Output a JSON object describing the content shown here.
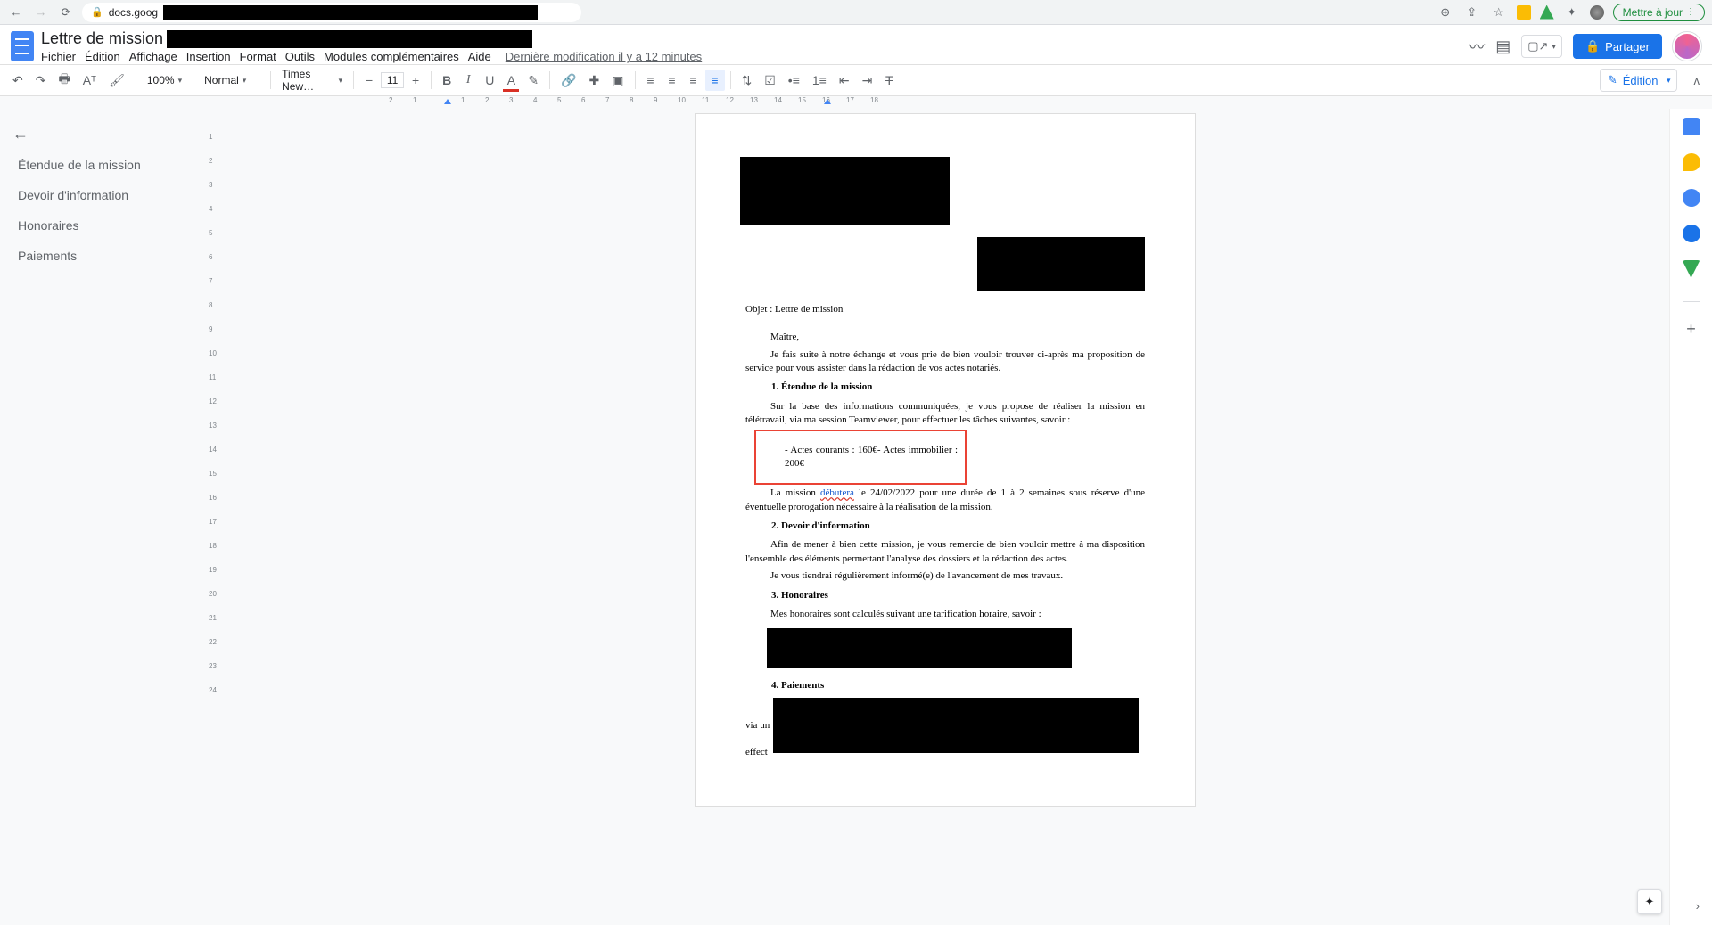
{
  "browser": {
    "url_visible": "docs.goog",
    "update_label": "Mettre à jour"
  },
  "doc": {
    "title": "Lettre de mission",
    "last_edit": "Dernière modification il y a 12 minutes"
  },
  "menus": {
    "file": "Fichier",
    "edit": "Édition",
    "view": "Affichage",
    "insert": "Insertion",
    "format": "Format",
    "tools": "Outils",
    "addons": "Modules complémentaires",
    "help": "Aide"
  },
  "header_actions": {
    "share": "Partager"
  },
  "toolbar": {
    "zoom": "100%",
    "style": "Normal",
    "font": "Times New…",
    "size": "11",
    "edit_mode": "Édition"
  },
  "outline": {
    "items": [
      {
        "label": "Étendue de la mission"
      },
      {
        "label": "Devoir d'information"
      },
      {
        "label": "Honoraires"
      },
      {
        "label": "Paiements"
      }
    ]
  },
  "document_body": {
    "subject": "Objet : Lettre de mission",
    "greeting": "Maître,",
    "intro": "Je fais suite à notre échange et vous prie de bien vouloir trouver ci-après ma proposition de service pour vous assister dans la rédaction de vos actes notariés.",
    "s1_title": "Étendue de la mission",
    "s1_p1": "Sur la base des informations communiquées, je vous propose de réaliser la mission en télétravail, via ma session Teamviewer, pour effectuer les tâches suivantes, savoir :",
    "s1_list": "- Actes courants : 160€- Actes immobilier : 200€",
    "s1_p2a": "La mission ",
    "s1_p2_link": "débutera",
    "s1_p2b": " le 24/02/2022 pour une durée de 1 à 2 semaines sous réserve d'une éventuelle prorogation nécessaire à la réalisation de la mission.",
    "s2_title": "Devoir d'information",
    "s2_p1": "Afin de mener à bien cette mission, je vous remercie de bien vouloir mettre à ma disposition l'ensemble des éléments permettant l'analyse des dossiers et la rédaction des actes.",
    "s2_p2": "Je vous tiendrai régulièrement informé(e) de l'avancement de mes travaux.",
    "s3_title": "Honoraires",
    "s3_p1": "Mes honoraires sont calculés suivant une tarification horaire, savoir :",
    "s4_title": "Paiements",
    "s4_via": "via un",
    "s4_effect": "effect"
  },
  "ruler_numbers": [
    "2",
    "1",
    "",
    "1",
    "2",
    "3",
    "4",
    "5",
    "6",
    "7",
    "8",
    "9",
    "10",
    "11",
    "12",
    "13",
    "14",
    "15",
    "16",
    "17",
    "18"
  ]
}
